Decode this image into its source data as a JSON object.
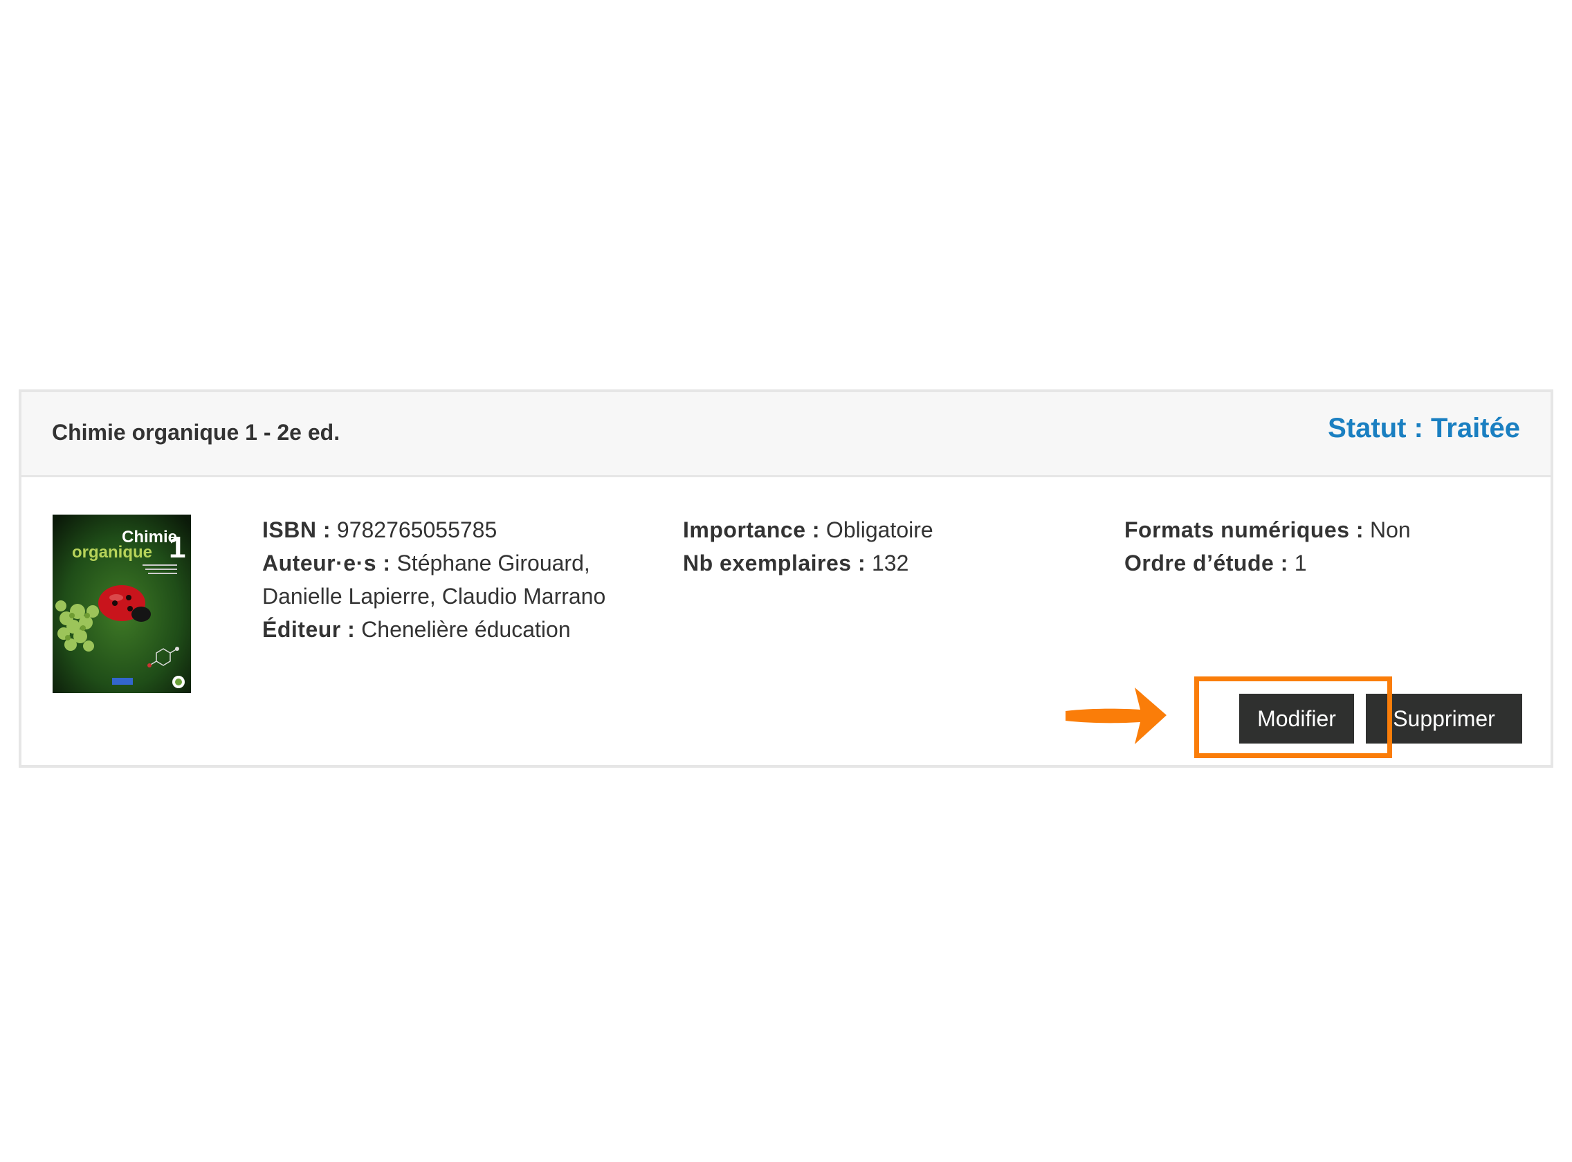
{
  "book": {
    "title": "Chimie organique 1 - 2e ed.",
    "status": "Statut : Traitée",
    "status_color": "#1a7fc1",
    "cover": {
      "title_line1": "Chimie",
      "title_line2": "organique",
      "number": "1"
    },
    "isbn_label": "ISBN :",
    "isbn_value": "9782765055785",
    "authors_label": "Auteur·e·s :",
    "authors_value": "Stéphane Girouard, Danielle Lapierre, Claudio Marrano",
    "publisher_label": "Éditeur :",
    "publisher_value": "Chenelière éducation",
    "importance_label": "Importance :",
    "importance_value": "Obligatoire",
    "copies_label": "Nb exemplaires :",
    "copies_value": "132",
    "digital_label": "Formats numériques :",
    "digital_value": "Non",
    "order_label": "Ordre d’étude :",
    "order_value": "1"
  },
  "actions": {
    "modify_label": "Modifier",
    "delete_label": "Supprimer"
  },
  "annotation": {
    "color": "#fa7d09",
    "target": "Modifier"
  }
}
